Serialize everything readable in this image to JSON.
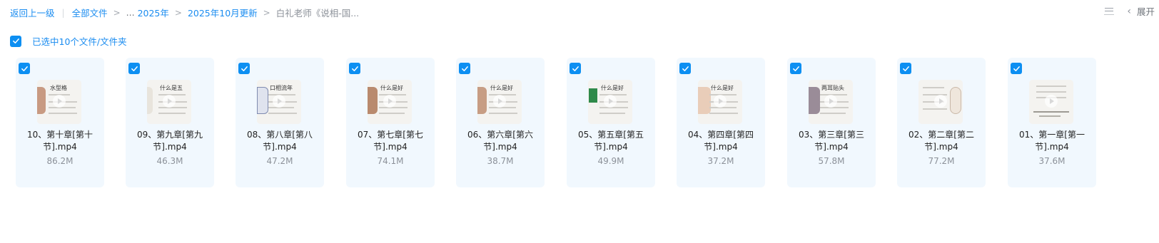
{
  "breadcrumb": {
    "back_label": "返回上一级",
    "root_label": "全部文件",
    "ellipsis": "...",
    "year_label": "2025年",
    "month_label": "2025年10月更新",
    "current_label": "白礼老师《说相-国..."
  },
  "toolbar": {
    "expand_label": "展开"
  },
  "selection": {
    "label": "已选中10个文件/文件夹",
    "checked": true
  },
  "files": [
    {
      "name_line1": "10、第十章[第十",
      "name_line2": "节].mp4",
      "size": "86.2M",
      "thumb_title": "水型格",
      "checked": true
    },
    {
      "name_line1": "09、第九章[第九",
      "name_line2": "节].mp4",
      "size": "46.3M",
      "thumb_title": "什么是五",
      "checked": true
    },
    {
      "name_line1": "08、第八章[第八",
      "name_line2": "节].mp4",
      "size": "47.2M",
      "thumb_title": "口相流年",
      "checked": true
    },
    {
      "name_line1": "07、第七章[第七",
      "name_line2": "节].mp4",
      "size": "74.1M",
      "thumb_title": "什么是好",
      "checked": true
    },
    {
      "name_line1": "06、第六章[第六",
      "name_line2": "节].mp4",
      "size": "38.7M",
      "thumb_title": "什么是好",
      "checked": true
    },
    {
      "name_line1": "05、第五章[第五",
      "name_line2": "节].mp4",
      "size": "49.9M",
      "thumb_title": "什么是好",
      "checked": true
    },
    {
      "name_line1": "04、第四章[第四",
      "name_line2": "节].mp4",
      "size": "37.2M",
      "thumb_title": "什么是好",
      "checked": true
    },
    {
      "name_line1": "03、第三章[第三",
      "name_line2": "节].mp4",
      "size": "57.8M",
      "thumb_title": "两耳贴头",
      "checked": true
    },
    {
      "name_line1": "02、第二章[第二",
      "name_line2": "节].mp4",
      "size": "77.2M",
      "thumb_title": "",
      "checked": true
    },
    {
      "name_line1": "01、第一章[第一",
      "name_line2": "节].mp4",
      "size": "37.6M",
      "thumb_title": "",
      "checked": true
    }
  ],
  "colors": {
    "accent": "#0d8ff2",
    "link": "#1a8cf0",
    "card_bg": "#f1f8fe",
    "muted_text": "#8c9199"
  }
}
